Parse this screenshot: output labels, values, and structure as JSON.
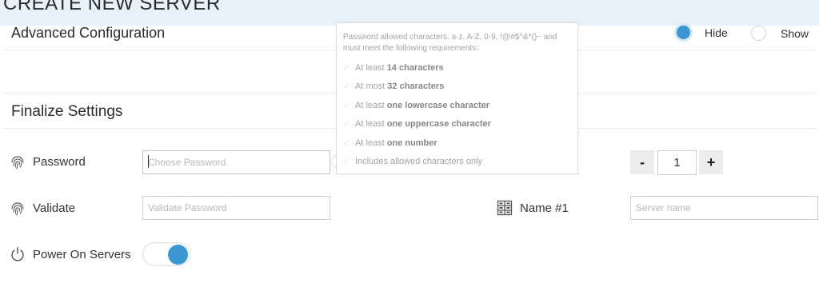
{
  "header": {
    "title": "CREATE NEW SERVER"
  },
  "advanced": {
    "title": "Advanced Configuration",
    "hide_label": "Hide",
    "show_label": "Show",
    "selected": "Hide"
  },
  "finalize": {
    "title": "Finalize Settings",
    "password_label": "Password",
    "password_placeholder": "Choose Password",
    "validate_label": "Validate",
    "validate_placeholder": "Validate Password",
    "power_label": "Power On Servers",
    "power_on": true,
    "name_label": "Name #1",
    "name_placeholder": "Server name",
    "stepper": {
      "minus": "-",
      "value": "1",
      "plus": "+"
    }
  },
  "tooltip": {
    "intro": "Password allowed characters: a-z, A-Z, 0-9, !@#$^&*()~ and must meet the following requirements:",
    "requirements": [
      {
        "pre": "At least",
        "bold": "14 characters",
        "post": ""
      },
      {
        "pre": "At most",
        "bold": "32 characters",
        "post": ""
      },
      {
        "pre": "At least",
        "bold": "one lowercase character",
        "post": ""
      },
      {
        "pre": "At least",
        "bold": "one uppercase character",
        "post": ""
      },
      {
        "pre": "At least",
        "bold": "one number",
        "post": ""
      },
      {
        "pre": "Includes allowed characters only",
        "bold": "",
        "post": ""
      }
    ]
  },
  "colors": {
    "accent": "#3a97d3",
    "header_bg": "#e8f1f8",
    "hint_text": "#a4a4a4"
  },
  "icons": {
    "password": "fingerprint-icon",
    "validate": "fingerprint-icon",
    "power": "power-icon",
    "name": "server-icon",
    "requirement": "check-icon"
  }
}
